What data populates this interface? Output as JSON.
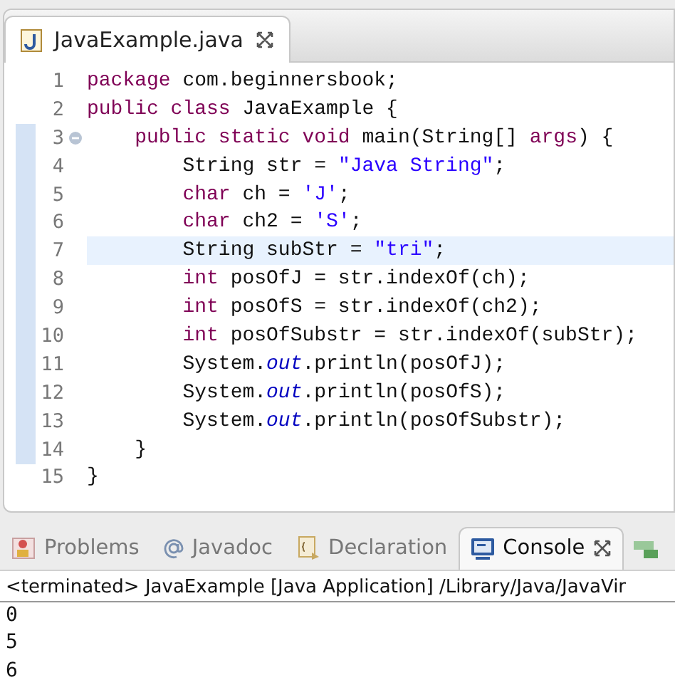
{
  "editor": {
    "tab": {
      "label": "JavaExample.java",
      "selected": true
    },
    "lines": [
      {
        "number": "1",
        "tokens": [
          {
            "kind": "kw",
            "text": "package"
          },
          {
            "kind": "text",
            "text": " com.beginnersbook;"
          }
        ]
      },
      {
        "number": "2",
        "tokens": [
          {
            "kind": "kw",
            "text": "public class"
          },
          {
            "kind": "text",
            "text": " JavaExample {"
          }
        ]
      },
      {
        "number": "3",
        "fold": true,
        "tokens": [
          {
            "kind": "kw",
            "text": "    public static void"
          },
          {
            "kind": "text",
            "text": " main(String[] "
          },
          {
            "kind": "kw",
            "text": "args"
          },
          {
            "kind": "text",
            "text": ") {"
          }
        ]
      },
      {
        "number": "4",
        "tokens": [
          {
            "kind": "text",
            "text": "        String str = "
          },
          {
            "kind": "str",
            "text": "\"Java String\""
          },
          {
            "kind": "text",
            "text": ";"
          }
        ]
      },
      {
        "number": "5",
        "tokens": [
          {
            "kind": "kw",
            "text": "        char"
          },
          {
            "kind": "text",
            "text": " ch = "
          },
          {
            "kind": "str",
            "text": "'J'"
          },
          {
            "kind": "text",
            "text": ";"
          }
        ]
      },
      {
        "number": "6",
        "tokens": [
          {
            "kind": "kw",
            "text": "        char"
          },
          {
            "kind": "text",
            "text": " ch2 = "
          },
          {
            "kind": "str",
            "text": "'S'"
          },
          {
            "kind": "text",
            "text": ";"
          }
        ]
      },
      {
        "number": "7",
        "current": true,
        "tokens": [
          {
            "kind": "text",
            "text": "        String subStr = "
          },
          {
            "kind": "str",
            "text": "\"tri\""
          },
          {
            "kind": "text",
            "text": ";"
          }
        ]
      },
      {
        "number": "8",
        "tokens": [
          {
            "kind": "kw",
            "text": "        int"
          },
          {
            "kind": "text",
            "text": " posOfJ = str.indexOf(ch);"
          }
        ]
      },
      {
        "number": "9",
        "tokens": [
          {
            "kind": "kw",
            "text": "        int"
          },
          {
            "kind": "text",
            "text": " posOfS = str.indexOf(ch2);"
          }
        ]
      },
      {
        "number": "10",
        "tokens": [
          {
            "kind": "kw",
            "text": "        int"
          },
          {
            "kind": "text",
            "text": " posOfSubstr = str.indexOf(subStr);"
          }
        ]
      },
      {
        "number": "11",
        "tokens": [
          {
            "kind": "text",
            "text": "        System."
          },
          {
            "kind": "field",
            "text": "out"
          },
          {
            "kind": "text",
            "text": ".println(posOfJ);"
          }
        ]
      },
      {
        "number": "12",
        "tokens": [
          {
            "kind": "text",
            "text": "        System."
          },
          {
            "kind": "field",
            "text": "out"
          },
          {
            "kind": "text",
            "text": ".println(posOfS);"
          }
        ]
      },
      {
        "number": "13",
        "tokens": [
          {
            "kind": "text",
            "text": "        System."
          },
          {
            "kind": "field",
            "text": "out"
          },
          {
            "kind": "text",
            "text": ".println(posOfSubstr);"
          }
        ]
      },
      {
        "number": "14",
        "tokens": [
          {
            "kind": "text",
            "text": "    }"
          }
        ]
      },
      {
        "number": "15",
        "tokens": [
          {
            "kind": "text",
            "text": "}"
          }
        ]
      }
    ]
  },
  "panel": {
    "tabs": [
      {
        "kind": "problems",
        "label": "Problems",
        "selected": false
      },
      {
        "kind": "javadoc",
        "label": "Javadoc",
        "selected": false
      },
      {
        "kind": "declaration",
        "label": "Declaration",
        "selected": false
      },
      {
        "kind": "console",
        "label": "Console",
        "selected": true
      }
    ],
    "console": {
      "header": "<terminated> JavaExample [Java Application] /Library/Java/JavaVir",
      "output": [
        "0",
        "5",
        "6"
      ]
    }
  }
}
